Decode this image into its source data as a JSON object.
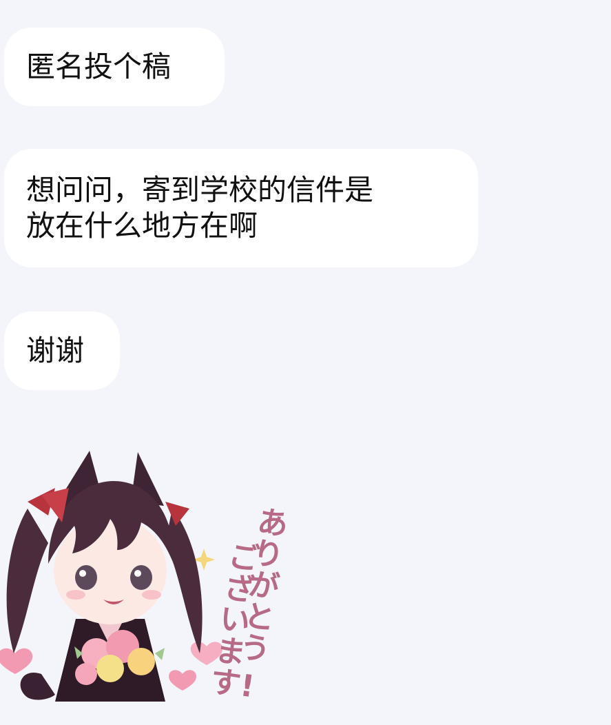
{
  "chat": {
    "messages": [
      {
        "text": "匿名投个稿"
      },
      {
        "text": "想问问，寄到学校的信件是\n放在什么地方在啊"
      },
      {
        "text": "谢谢"
      }
    ]
  },
  "sticker": {
    "line1": "ありがとう",
    "line2": "ございます!",
    "colors": {
      "hair": "#4a2c3c",
      "skin": "#fde9e4",
      "bow": "#b8343d",
      "text": "#b76a86",
      "heart": "#f28aa6"
    }
  }
}
